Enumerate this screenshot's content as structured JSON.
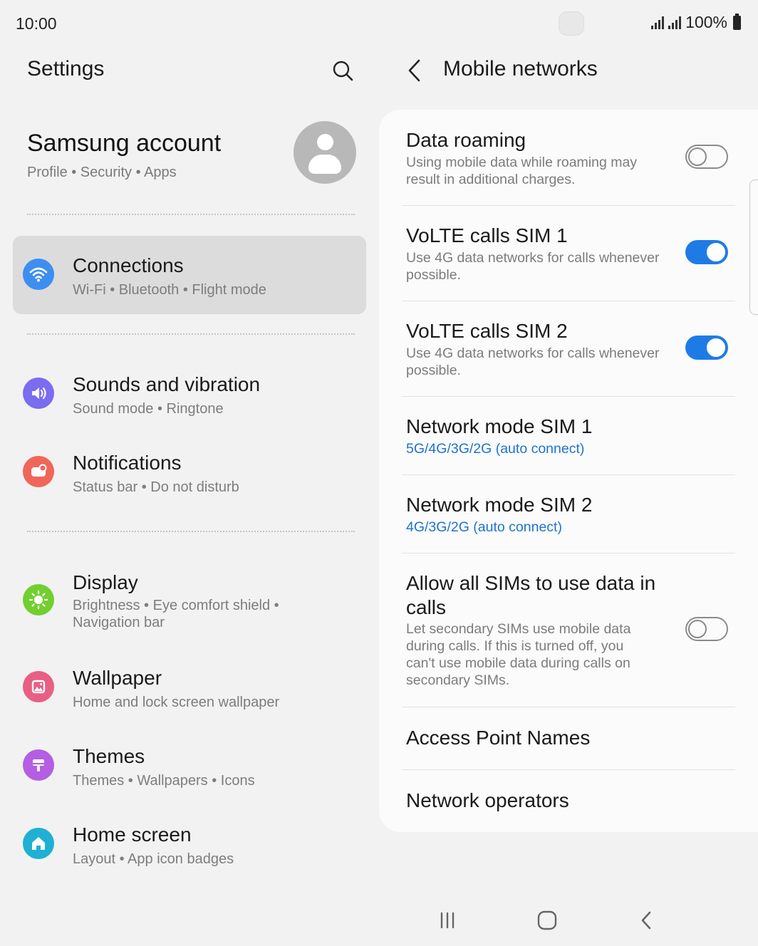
{
  "status_bar": {
    "time": "10:00",
    "battery": "100%",
    "icons": [
      "signal-sim1-icon",
      "signal-sim2-icon",
      "battery-icon"
    ]
  },
  "left": {
    "title": "Settings",
    "search_icon": "search-icon",
    "account": {
      "name": "Samsung account",
      "sub": "Profile  •  Security  •  Apps",
      "avatar_icon": "avatar-icon"
    },
    "items": [
      {
        "label": "Connections",
        "sub": "Wi-Fi  •  Bluetooth  •  Flight mode",
        "icon": "wifi-icon",
        "color": "#3d8ef0",
        "selected": true
      },
      {
        "label": "Sounds and vibration",
        "sub": "Sound mode  •  Ringtone",
        "icon": "speaker-icon",
        "color": "#7b6cf0"
      },
      {
        "label": "Notifications",
        "sub": "Status bar  •  Do not disturb",
        "icon": "notification-icon",
        "color": "#f0665a"
      },
      {
        "label": "Display",
        "sub": "Brightness  •  Eye comfort shield  •  Navigation bar",
        "icon": "brightness-icon",
        "color": "#72cf2f"
      },
      {
        "label": "Wallpaper",
        "sub": "Home and lock screen wallpaper",
        "icon": "wallpaper-icon",
        "color": "#e85f84"
      },
      {
        "label": "Themes",
        "sub": "Themes  •  Wallpapers  •  Icons",
        "icon": "themes-icon",
        "color": "#b45ee3"
      },
      {
        "label": "Home screen",
        "sub": "Layout  •  App icon badges",
        "icon": "home-icon",
        "color": "#1fb0d3"
      }
    ]
  },
  "right": {
    "title": "Mobile networks",
    "back_icon": "back-arrow-icon",
    "rows": [
      {
        "title": "Data roaming",
        "sub": "Using mobile data while roaming may result in additional charges.",
        "toggle": "off"
      },
      {
        "title": "VoLTE calls SIM 1",
        "sub": "Use 4G data networks for calls whenever possible.",
        "toggle": "on"
      },
      {
        "title": "VoLTE calls SIM 2",
        "sub": "Use 4G data networks for calls whenever possible.",
        "toggle": "on"
      },
      {
        "title": "Network mode SIM 1",
        "sub": "5G/4G/3G/2G (auto connect)",
        "sub_color": "#1e73cf"
      },
      {
        "title": "Network mode SIM 2",
        "sub": "4G/3G/2G (auto connect)",
        "sub_color": "#1e73cf"
      },
      {
        "title": "Allow all SIMs to use data in calls",
        "sub": "Let secondary SIMs use mobile data during calls. If this is turned off, you can't use mobile data during calls on secondary SIMs.",
        "toggle": "off"
      },
      {
        "title": "Access Point Names"
      },
      {
        "title": "Network operators"
      }
    ]
  },
  "nav_bar": {
    "recents_icon": "recents-icon",
    "home_icon": "home-button-icon",
    "back_icon": "back-icon"
  },
  "colors": {
    "accent": "#1e7be6",
    "background": "#f2f2f2",
    "card": "#fbfbfb"
  }
}
